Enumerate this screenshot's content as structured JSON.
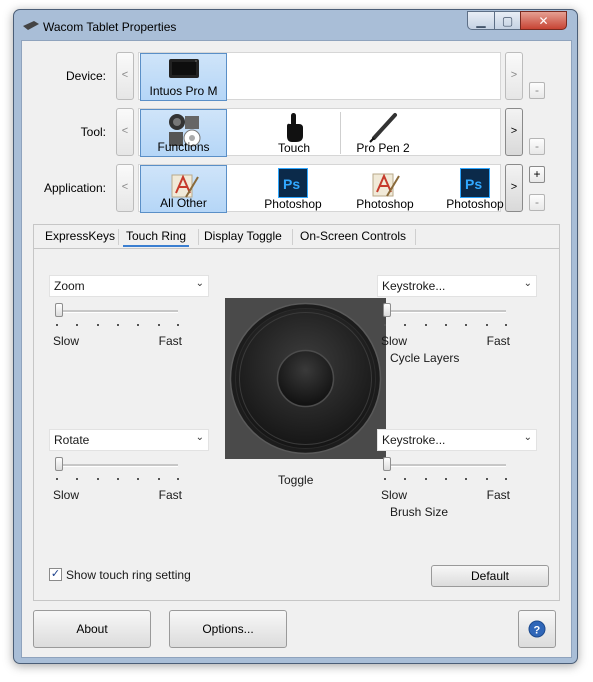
{
  "window": {
    "title": "Wacom Tablet Properties"
  },
  "device_row": {
    "label": "Device:",
    "items": [
      {
        "label": "Intuos Pro M",
        "selected": true
      }
    ]
  },
  "tool_row": {
    "label": "Tool:",
    "items": [
      {
        "label": "Functions",
        "selected": true
      },
      {
        "label": "Touch"
      },
      {
        "label": "Pro Pen 2"
      }
    ]
  },
  "app_row": {
    "label": "Application:",
    "items": [
      {
        "label": "All Other",
        "selected": true
      },
      {
        "label": "Photoshop"
      },
      {
        "label": "Photoshop"
      },
      {
        "label": "Photoshop"
      }
    ]
  },
  "controls": {
    "prev": "<",
    "next": ">",
    "add": "+",
    "remove": "-"
  },
  "tabs": [
    "ExpressKeys",
    "Touch Ring",
    "Display Toggle",
    "On-Screen Controls"
  ],
  "active_tab": "Touch Ring",
  "ring": {
    "left_top": {
      "function": "Zoom",
      "slow": "Slow",
      "fast": "Fast",
      "speed": 0
    },
    "left_bottom": {
      "function": "Rotate",
      "slow": "Slow",
      "fast": "Fast",
      "speed": 0
    },
    "right_top": {
      "function": "Keystroke...",
      "slow": "Slow",
      "fast": "Fast",
      "speed": 0,
      "name": "Cycle Layers"
    },
    "right_bottom": {
      "function": "Keystroke...",
      "slow": "Slow",
      "fast": "Fast",
      "speed": 0,
      "name": "Brush Size"
    },
    "center_label": "Toggle"
  },
  "show_setting": {
    "label": "Show touch ring setting",
    "checked": true
  },
  "buttons": {
    "default": "Default",
    "about": "About",
    "options": "Options..."
  },
  "icons": [
    "tablet-icon",
    "functions-icon",
    "touch-hand-icon",
    "pen-icon",
    "all-other-icon",
    "photoshop-icon",
    "help-icon"
  ],
  "colors": {
    "selection": "#cfe4f9",
    "tab_underline": "#3b7fd1",
    "photoshop": "#0b2a4a"
  }
}
